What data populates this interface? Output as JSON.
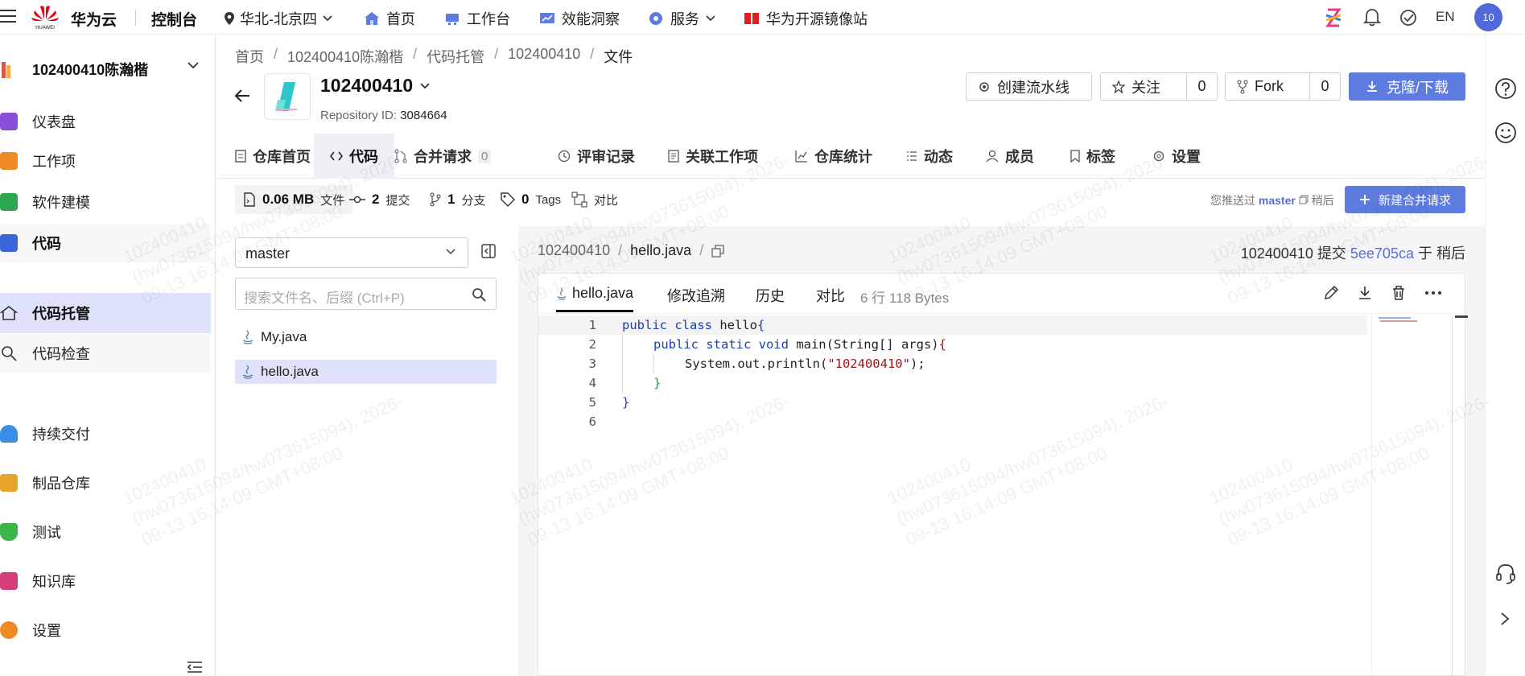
{
  "topbar": {
    "brand": "华为云",
    "brand_sub": "HUAWEI",
    "console": "控制台",
    "region": "华北-北京四",
    "nav": [
      {
        "label": "首页"
      },
      {
        "label": "工作台"
      },
      {
        "label": "效能洞察"
      },
      {
        "label": "服务"
      },
      {
        "label": "华为开源镜像站"
      }
    ],
    "lang": "EN",
    "avatar": "10"
  },
  "sidebar": {
    "project": "102400410陈瀚楷",
    "items": [
      {
        "label": "仪表盘"
      },
      {
        "label": "工作项"
      },
      {
        "label": "软件建模"
      },
      {
        "label": "代码"
      },
      {
        "label": "代码托管"
      },
      {
        "label": "代码检查"
      },
      {
        "label": "持续交付"
      },
      {
        "label": "制品仓库"
      },
      {
        "label": "测试"
      },
      {
        "label": "知识库"
      },
      {
        "label": "设置"
      }
    ]
  },
  "breadcrumb": [
    "首页",
    "102400410陈瀚楷",
    "代码托管",
    "102400410",
    "文件"
  ],
  "repo": {
    "name": "102400410",
    "id_label": "Repository ID:",
    "id_value": "3084664"
  },
  "actions": {
    "pipeline": "创建流水线",
    "watch": "关注",
    "watch_count": "0",
    "fork": "Fork",
    "fork_count": "0",
    "clone": "克隆/下载"
  },
  "tabs": [
    {
      "label": "仓库首页"
    },
    {
      "label": "代码"
    },
    {
      "label": "合并请求",
      "badge": "0"
    },
    {
      "label": "评审记录"
    },
    {
      "label": "关联工作项"
    },
    {
      "label": "仓库统计"
    },
    {
      "label": "动态"
    },
    {
      "label": "成员"
    },
    {
      "label": "标签"
    },
    {
      "label": "设置"
    }
  ],
  "stats": {
    "size": "0.06 MB",
    "size_unit": "文件",
    "commits": "2",
    "commits_unit": "提交",
    "branches": "1",
    "branches_unit": "分支",
    "tags": "0",
    "tags_unit": "Tags",
    "compare": "对比",
    "pushed_prefix": "您推送过",
    "pushed_branch": "master",
    "pushed_suffix": "稍后",
    "new_pr": "新建合并请求"
  },
  "files": {
    "branch": "master",
    "search_placeholder": "搜索文件名、后缀 (Ctrl+P)",
    "list": [
      {
        "name": "My.java"
      },
      {
        "name": "hello.java"
      }
    ]
  },
  "path": {
    "repo": "102400410",
    "file": "hello.java"
  },
  "commit": {
    "author": "102400410",
    "action": "提交",
    "hash": "5ee705ca",
    "when": "于 稍后"
  },
  "code_tabs": {
    "file": "hello.java",
    "blame": "修改追溯",
    "history": "历史",
    "compare": "对比",
    "lines": "6 行",
    "size": "118 Bytes"
  },
  "code": {
    "line_numbers": [
      "1",
      "2",
      "3",
      "4",
      "5",
      "6"
    ],
    "l1a": "public class",
    "l1b": " hello",
    "l1c": "{",
    "l2a": "public static void",
    "l2b": " main(String[] args)",
    "l2c": "{",
    "l3a": "System.out.println(",
    "l3b": "\"102400410\"",
    "l3c": ");",
    "l4": "}",
    "l5": "}"
  },
  "watermark": {
    "line1": "102400410",
    "line2": "(hw073615094/hw073615094), 2026-",
    "line3": "09-13 16:14:09 GMT+08:00"
  },
  "colors": {
    "primary": "#5e7ce0",
    "active_bg": "#dee3fb",
    "link": "#5a6fd6"
  }
}
